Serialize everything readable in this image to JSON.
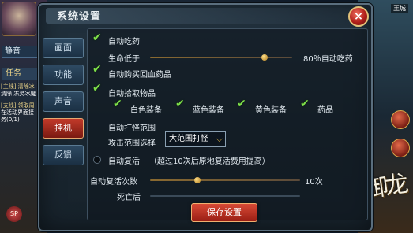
{
  "panel": {
    "title": "系统设置",
    "close_label": "×"
  },
  "tabs": [
    {
      "label": "画面",
      "active": false
    },
    {
      "label": "功能",
      "active": false
    },
    {
      "label": "声音",
      "active": false
    },
    {
      "label": "挂机",
      "active": true
    },
    {
      "label": "反馈",
      "active": false
    }
  ],
  "settings": {
    "auto_potion": {
      "label": "自动吃药",
      "checked": true
    },
    "hp_low": {
      "label": "生命低于",
      "suffix": "80％自动吃药",
      "value_percent": 80
    },
    "auto_buy": {
      "label": "自动购买回血药品",
      "checked": true
    },
    "auto_pickup": {
      "label": "自动拾取物品",
      "checked": true
    },
    "pickup_items": [
      {
        "label": "白色装备",
        "checked": true
      },
      {
        "label": "蓝色装备",
        "checked": true
      },
      {
        "label": "黄色装备",
        "checked": true
      },
      {
        "label": "药品",
        "checked": true
      }
    ],
    "auto_attack_range": {
      "label": "自动打怪范围"
    },
    "attack_range_select": {
      "label": "攻击范围选择",
      "value": "大范围打怪"
    },
    "auto_revive": {
      "label": "自动复活",
      "note": "（超过10次后原地复活费用提高）",
      "checked": false
    },
    "revive_count": {
      "label": "自动复活次数",
      "suffix": "10次",
      "value": 10
    },
    "after_death": {
      "label": "死亡后"
    },
    "save_label": "保存设置"
  },
  "background": {
    "quiet_label": "静音",
    "task_label": "任务",
    "quest_lines": [
      "[主线] 清除冰",
      "清除 冻灵冰魔",
      "[支线] 领取周",
      "在活动界面接",
      "务(0/1)",
      ""
    ],
    "minimap_label": "王城",
    "logo_text": "御龙",
    "sp_label": "SP"
  },
  "colors": {
    "accent_red": "#c23a2a",
    "check_green": "#7fe04a",
    "gold": "#f2c14a"
  }
}
